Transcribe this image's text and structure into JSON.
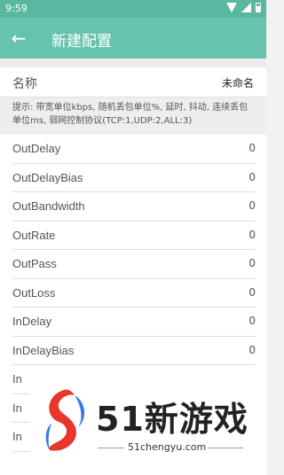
{
  "status_bar": {
    "time": "9:59"
  },
  "app_bar": {
    "title": "新建配置"
  },
  "name_field": {
    "label": "名称",
    "value": "未命名"
  },
  "hint": "提示: 带宽单位kbps, 随机丢包单位%, 延时, 抖动, 连续丢包单位ms, 弱网控制协议(TCP:1,UDP:2,ALL:3)",
  "params": [
    {
      "label": "OutDelay",
      "value": "0"
    },
    {
      "label": "OutDelayBias",
      "value": "0"
    },
    {
      "label": "OutBandwidth",
      "value": "0"
    },
    {
      "label": "OutRate",
      "value": "0"
    },
    {
      "label": "OutPass",
      "value": "0"
    },
    {
      "label": "OutLoss",
      "value": "0"
    },
    {
      "label": "InDelay",
      "value": "0"
    },
    {
      "label": "InDelayBias",
      "value": "0"
    },
    {
      "label": "In",
      "value": ""
    },
    {
      "label": "In",
      "value": ""
    },
    {
      "label": "In",
      "value": ""
    }
  ],
  "watermark": {
    "text": "51新游戏",
    "url": "51chengyu.com"
  }
}
